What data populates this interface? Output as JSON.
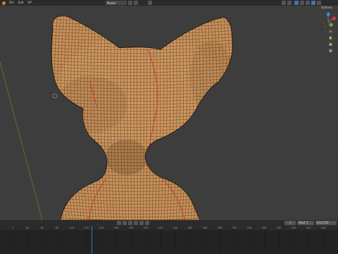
{
  "menu": {
    "items": [
      "File",
      "Edit",
      "UP"
    ]
  },
  "viewport_header": {
    "mode_label": "Model",
    "options_label": "Options"
  },
  "navigation": {
    "x_label": "X",
    "y_label": "Y",
    "z_label": "Z"
  },
  "timeline": {
    "start_label": "Start",
    "start_value": "1",
    "end_label": "End",
    "end_value": "250",
    "current_frame": "1",
    "ruler_ticks": [
      "1",
      "40",
      "60",
      "80",
      "100",
      "120",
      "140",
      "160",
      "180",
      "200",
      "220",
      "240",
      "260",
      "280",
      "300",
      "320",
      "340",
      "360",
      "380",
      "400",
      "420",
      "440"
    ]
  },
  "colors": {
    "viewport_bg": "#3d3d3d",
    "mesh_fill": "#c8915a",
    "wire": "#2a1a0c",
    "seam": "#d02020",
    "x_axis": "#e04050",
    "y_axis": "#70b030",
    "z_axis": "#4a8ae0",
    "accent": "#4772b3"
  }
}
